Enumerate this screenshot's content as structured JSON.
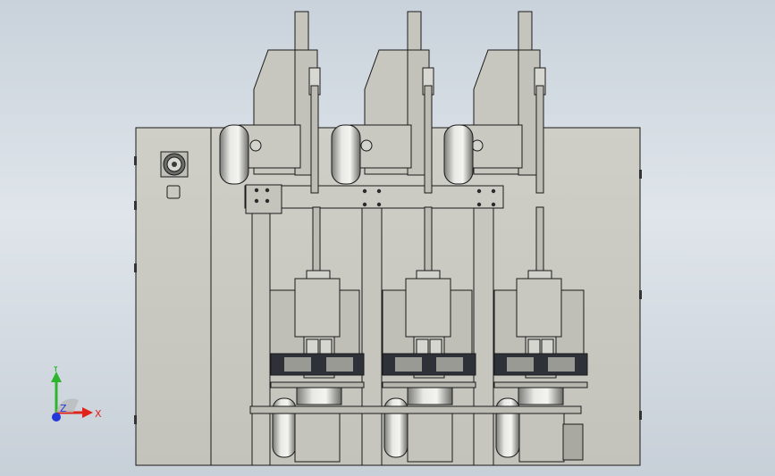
{
  "viewport": {
    "model_stations": 3,
    "fill_color": "#c8c8c0",
    "shadow_color": "#8a8a85",
    "dark_color": "#30343a",
    "line_color": "#1a1a1a"
  },
  "triad": {
    "x_label": "X",
    "y_label": "Y",
    "z_label": "Z",
    "x_color": "#e0241b",
    "y_color": "#2db52d",
    "z_color": "#2438d8"
  }
}
